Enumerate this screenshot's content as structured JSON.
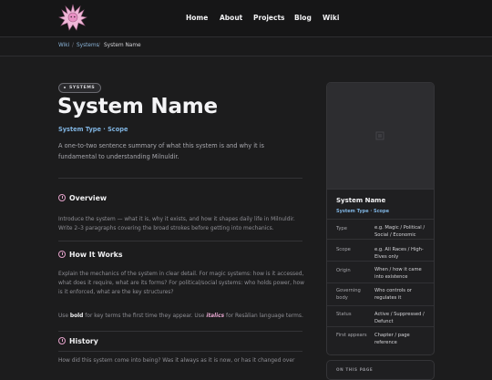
{
  "nav": {
    "items": [
      "Home",
      "About",
      "Projects",
      "Blog",
      "Wiki"
    ]
  },
  "breadcrumb": {
    "wiki": "Wiki",
    "systems": "Systems",
    "current": "System Name",
    "sep": "/"
  },
  "badge": "SYSTEMS",
  "title": "System Name",
  "subtitle": "System Type · Scope",
  "lede": "A one-to-two sentence summary of what this system is and why it is fundamental to understanding Milnuldir.",
  "sections": {
    "overview": {
      "heading": "Overview",
      "body": "Introduce the system — what it is, why it exists, and how it shapes daily life in Milnuldir. Write 2–3 paragraphs covering the broad strokes before getting into mechanics."
    },
    "how": {
      "heading": "How It Works",
      "body1": "Explain the mechanics of the system in clear detail. For magic systems: how is it accessed, what does it require, what are its forms? For political/social systems: who holds power, how is it enforced, what are the key structures?",
      "body2_pre": "Use ",
      "body2_bold": "bold",
      "body2_mid": " for key terms the first time they appear. Use ",
      "body2_italic": "italics",
      "body2_post": " for Resälian language terms."
    },
    "history": {
      "heading": "History",
      "body": "How did this system come into being? Was it always as it is now, or has it changed over"
    }
  },
  "infobox": {
    "title": "System Name",
    "subtitle": "System Type · Scope",
    "rows": [
      {
        "key": "Type",
        "value": "e.g. Magic / Political / Social / Economic"
      },
      {
        "key": "Scope",
        "value": "e.g. All Races / High-Elves only"
      },
      {
        "key": "Origin",
        "value": "When / how it came into existence"
      },
      {
        "key": "Governing body",
        "value": "Who controls or regulates it"
      },
      {
        "key": "Status",
        "value": "Active / Suppressed / Defunct"
      },
      {
        "key": "First appears",
        "value": "Chapter / page reference"
      }
    ]
  },
  "toc": {
    "label": "ON THIS PAGE"
  },
  "colors": {
    "accent_blue": "#7fb3e0",
    "accent_pink": "#e2a0c8",
    "bg": "#1c1c1d"
  }
}
